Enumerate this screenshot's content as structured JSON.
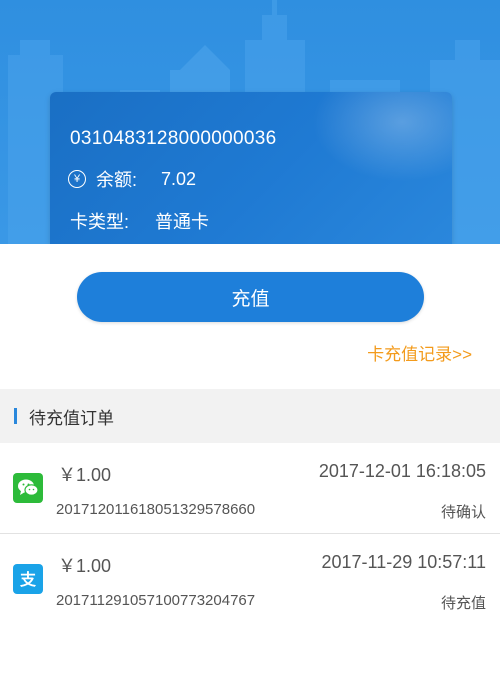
{
  "card": {
    "number": "0310483128000000036",
    "balance_label": "余额:",
    "balance_value": "7.02",
    "type_label": "卡类型:",
    "type_value": "普通卡",
    "currency_icon": "¥"
  },
  "actions": {
    "recharge_label": "充值",
    "record_link": "卡充值记录>>"
  },
  "pending": {
    "title": "待充值订单",
    "orders": [
      {
        "pay_icon": "wechat-pay-icon",
        "amount": "￥1.00",
        "time": "2017-12-01 16:18:05",
        "order_no": "20171201161805132957866​0",
        "status": "待确认"
      },
      {
        "pay_icon": "alipay-icon",
        "amount": "￥1.00",
        "time": "2017-11-29 10:57:11",
        "order_no": "20171129105710077320476​7",
        "status": "待充值"
      }
    ]
  },
  "colors": {
    "primary": "#1e7fda",
    "link": "#f39b1c",
    "wechat": "#2dbb3a",
    "alipay": "#1aa3e8"
  }
}
